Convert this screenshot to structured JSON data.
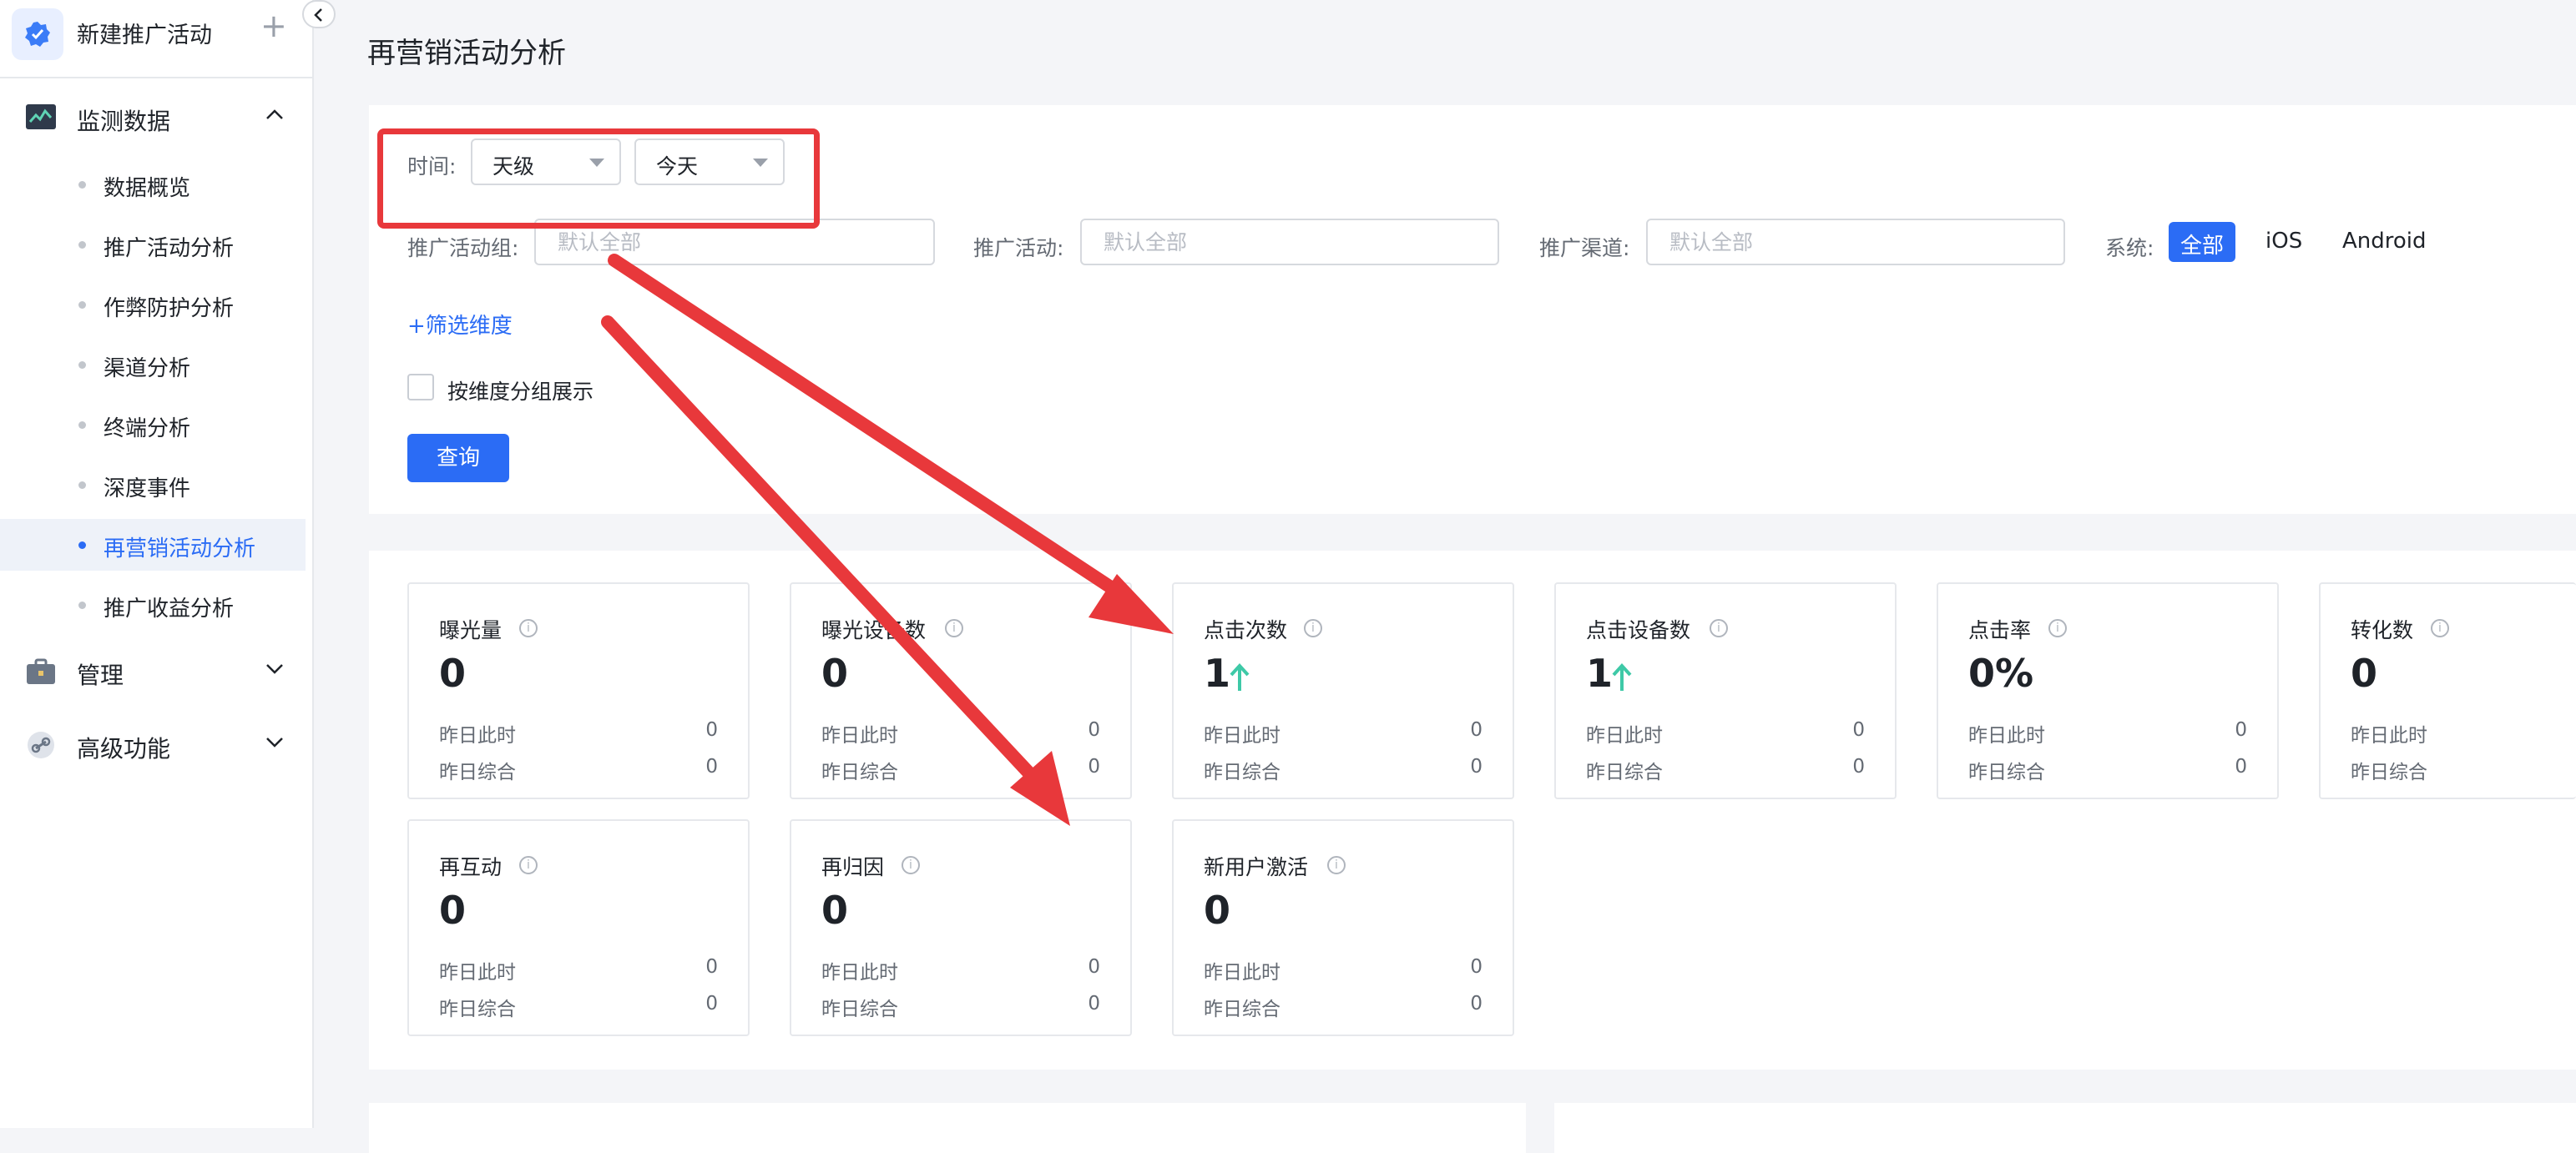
{
  "sidebar": {
    "new_campaign": "新建推广活动",
    "groups": {
      "monitor": "监测数据",
      "manage": "管理",
      "advanced": "高级功能"
    },
    "items": [
      {
        "label": "数据概览",
        "active": false
      },
      {
        "label": "推广活动分析",
        "active": false
      },
      {
        "label": "作弊防护分析",
        "active": false
      },
      {
        "label": "渠道分析",
        "active": false
      },
      {
        "label": "终端分析",
        "active": false
      },
      {
        "label": "深度事件",
        "active": false
      },
      {
        "label": "再营销活动分析",
        "active": true
      },
      {
        "label": "推广收益分析",
        "active": false
      }
    ]
  },
  "page": {
    "title": "再营销活动分析"
  },
  "filters": {
    "time_label": "时间:",
    "granularity": "天级",
    "range": "今天",
    "campaign_group_label": "推广活动组:",
    "campaign_group_placeholder": "默认全部",
    "campaign_label": "推广活动:",
    "campaign_placeholder": "默认全部",
    "channel_label": "推广渠道:",
    "channel_placeholder": "默认全部",
    "system_label": "系统:",
    "system_options": [
      "全部",
      "iOS",
      "Android"
    ],
    "system_selected": "全部",
    "add_dimension": "+筛选维度",
    "group_by_label": "按维度分组展示",
    "query_button": "查询"
  },
  "metrics": [
    {
      "title": "曝光量",
      "value": "0",
      "trend_up": false,
      "yesterday_same_time_label": "昨日此时",
      "yesterday_same_time": "0",
      "yesterday_total_label": "昨日综合",
      "yesterday_total": "0"
    },
    {
      "title": "曝光设备数",
      "value": "0",
      "trend_up": false,
      "yesterday_same_time_label": "昨日此时",
      "yesterday_same_time": "0",
      "yesterday_total_label": "昨日综合",
      "yesterday_total": "0"
    },
    {
      "title": "点击次数",
      "value": "1",
      "trend_up": true,
      "yesterday_same_time_label": "昨日此时",
      "yesterday_same_time": "0",
      "yesterday_total_label": "昨日综合",
      "yesterday_total": "0"
    },
    {
      "title": "点击设备数",
      "value": "1",
      "trend_up": true,
      "yesterday_same_time_label": "昨日此时",
      "yesterday_same_time": "0",
      "yesterday_total_label": "昨日综合",
      "yesterday_total": "0"
    },
    {
      "title": "点击率",
      "value": "0%",
      "trend_up": false,
      "yesterday_same_time_label": "昨日此时",
      "yesterday_same_time": "0",
      "yesterday_total_label": "昨日综合",
      "yesterday_total": "0"
    },
    {
      "title": "转化数",
      "value": "0",
      "trend_up": false,
      "yesterday_same_time_label": "昨日此时",
      "yesterday_same_time": "",
      "yesterday_total_label": "昨日综合",
      "yesterday_total": ""
    },
    {
      "title": "再互动",
      "value": "0",
      "trend_up": false,
      "yesterday_same_time_label": "昨日此时",
      "yesterday_same_time": "0",
      "yesterday_total_label": "昨日综合",
      "yesterday_total": "0"
    },
    {
      "title": "再归因",
      "value": "0",
      "trend_up": false,
      "yesterday_same_time_label": "昨日此时",
      "yesterday_same_time": "0",
      "yesterday_total_label": "昨日综合",
      "yesterday_total": "0"
    },
    {
      "title": "新用户激活",
      "value": "0",
      "trend_up": false,
      "yesterday_same_time_label": "昨日此时",
      "yesterday_same_time": "0",
      "yesterday_total_label": "昨日综合",
      "yesterday_total": "0"
    }
  ],
  "colors": {
    "primary": "#2b6cf5",
    "trend_up": "#3ec9a7",
    "annotation": "#e8383b"
  }
}
